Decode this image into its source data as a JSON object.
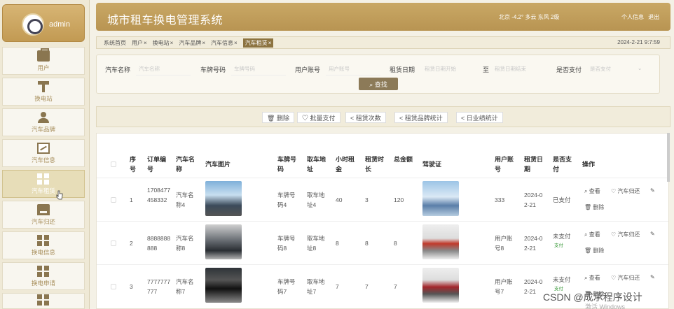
{
  "user": {
    "name": "admin"
  },
  "sidebar": {
    "items": [
      {
        "label": "用户",
        "icon": "briefcase-icon"
      },
      {
        "label": "换电站",
        "icon": "station-icon"
      },
      {
        "label": "汽车品牌",
        "icon": "user-icon"
      },
      {
        "label": "汽车信息",
        "icon": "chart-icon"
      },
      {
        "label": "汽车租赁",
        "icon": "grid-icon",
        "active": true
      },
      {
        "label": "汽车归还",
        "icon": "box-icon"
      },
      {
        "label": "换电信息",
        "icon": "grid-icon"
      },
      {
        "label": "换电申请",
        "icon": "grid-icon"
      }
    ]
  },
  "header": {
    "title": "城市租车换电管理系统",
    "weather": "北京  -4.2° 多云 东风 2级",
    "profile": "个人信息",
    "logout": "退出"
  },
  "tabs": [
    {
      "label": "系统首页"
    },
    {
      "label": "用户",
      "close": "×"
    },
    {
      "label": "换电站",
      "close": "×"
    },
    {
      "label": "汽车品牌",
      "close": "×"
    },
    {
      "label": "汽车信息",
      "close": "×"
    },
    {
      "label": "汽车租赁",
      "close": "×",
      "active": true
    }
  ],
  "datetime": "2024-2-21 9:7:59",
  "search": {
    "car_name_label": "汽车名称",
    "car_name_placeholder": "汽车名称",
    "plate_label": "车牌号码",
    "plate_placeholder": "车牌号码",
    "account_label": "用户账号",
    "account_placeholder": "用户账号",
    "date_label": "租赁日期",
    "date_start": "租赁日期开始",
    "date_to": "至",
    "date_end": "租赁日期结束",
    "paid_label": "是否支付",
    "paid_placeholder": "是否支付",
    "search_button": "查找"
  },
  "toolbar": {
    "delete": "删除",
    "batch_pay": "批量支付",
    "rent_count": "租赁次数",
    "brand_stats": "租赁品牌统计",
    "daily_stats": "日业绩统计"
  },
  "table": {
    "headers": {
      "index": "序号",
      "order_no": "订单编号",
      "car_name": "汽车名称",
      "car_image": "汽车图片",
      "plate": "车牌号码",
      "pickup": "取车地址",
      "hourly_rent": "小时租金",
      "rent_hours": "租赁时长",
      "total": "总金额",
      "license": "驾驶证",
      "account": "用户账号",
      "rent_date": "租赁日期",
      "paid": "是否支付",
      "actions": "操作"
    },
    "rows": [
      {
        "index": "1",
        "order_no": "1708477458332",
        "car_name": "汽车名称4",
        "plate": "车牌号码4",
        "pickup": "取车地址4",
        "hourly_rent": "40",
        "rent_hours": "3",
        "total": "120",
        "account": "333",
        "rent_date": "2024-02-21",
        "paid": "已支付",
        "paid_sub": ""
      },
      {
        "index": "2",
        "order_no": "8888888888",
        "car_name": "汽车名称8",
        "plate": "车牌号码8",
        "pickup": "取车地址8",
        "hourly_rent": "8",
        "rent_hours": "8",
        "total": "8",
        "account": "用户账号8",
        "rent_date": "2024-02-21",
        "paid": "未支付",
        "paid_sub": "支付"
      },
      {
        "index": "3",
        "order_no": "7777777777",
        "car_name": "汽车名称7",
        "plate": "车牌号码7",
        "pickup": "取车地址7",
        "hourly_rent": "7",
        "rent_hours": "7",
        "total": "7",
        "account": "用户账号7",
        "rent_date": "2024-02-21",
        "paid": "未支付",
        "paid_sub": "支付"
      }
    ],
    "actions": {
      "view": "查看",
      "return": "汽车归还",
      "delete": "删除"
    }
  },
  "watermark": "CSDN @成承程序设计",
  "watermark_sub": "激活 Windows"
}
